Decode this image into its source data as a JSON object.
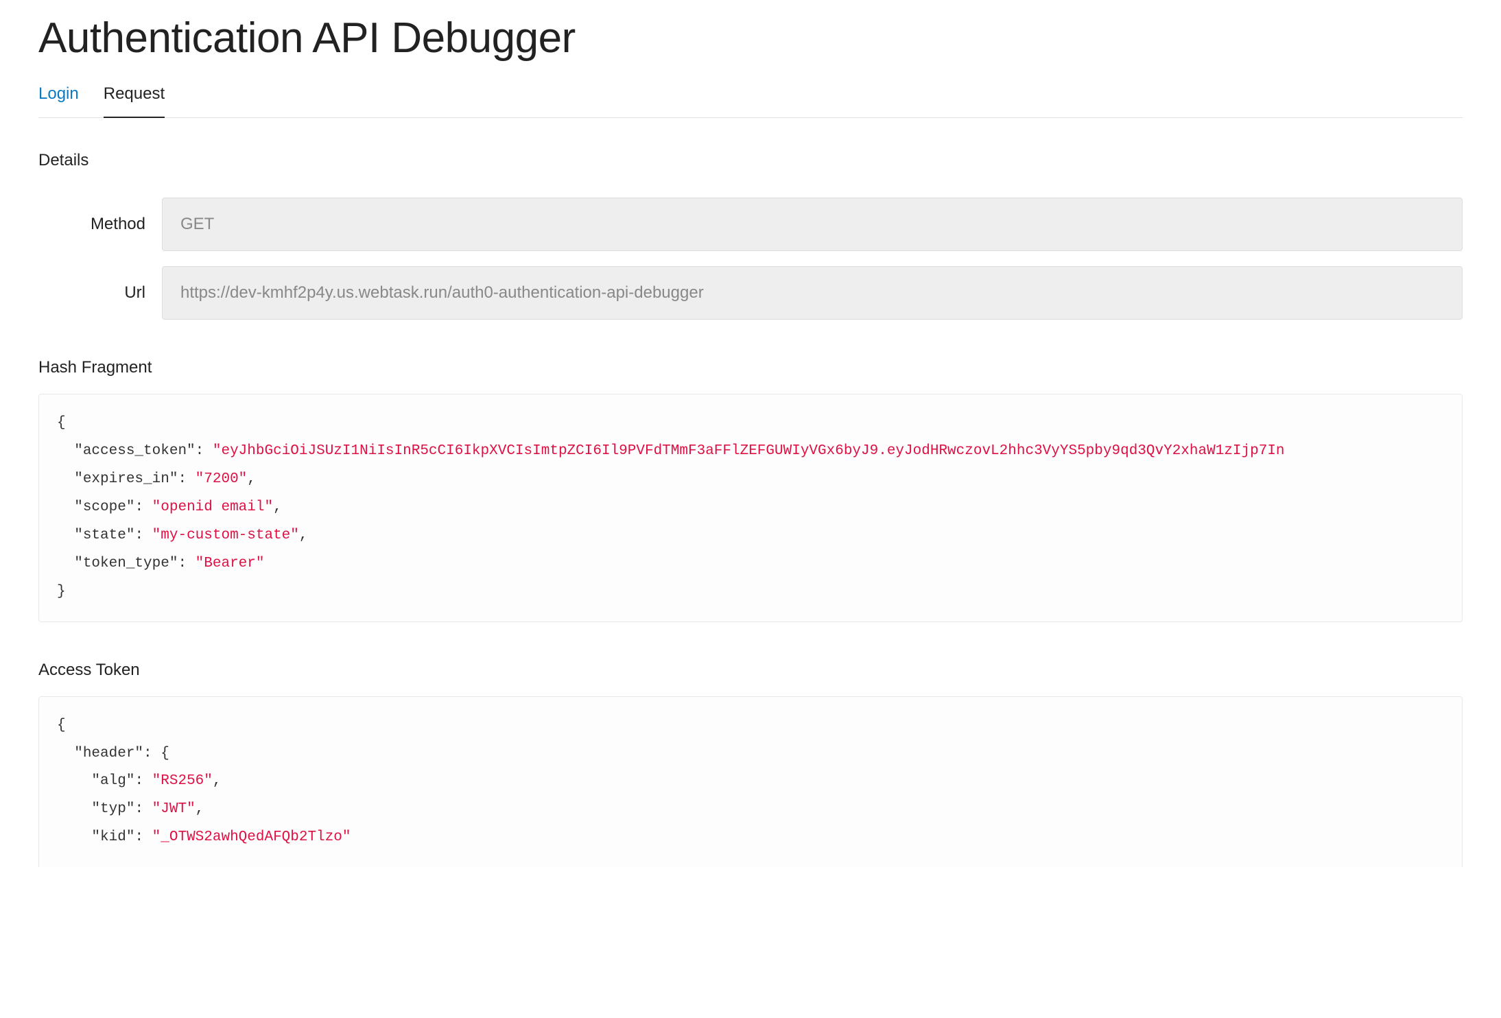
{
  "page": {
    "title": "Authentication API Debugger"
  },
  "tabs": {
    "login": "Login",
    "request": "Request"
  },
  "sections": {
    "details": "Details",
    "hash_fragment": "Hash Fragment",
    "access_token": "Access Token"
  },
  "details": {
    "method_label": "Method",
    "method_value": "GET",
    "url_label": "Url",
    "url_value": "https://dev-kmhf2p4y.us.webtask.run/auth0-authentication-api-debugger"
  },
  "hash_fragment": {
    "access_token_key": "\"access_token\"",
    "access_token_value": "\"eyJhbGciOiJSUzI1NiIsInR5cCI6IkpXVCIsImtpZCI6Il9PVFdTMmF3aFFlZEFGUWIyVGx6byJ9.eyJodHRwczovL2hhc3VyYS5pby9qd3QvY2xhaW1zIjp7In",
    "expires_in_key": "\"expires_in\"",
    "expires_in_value": "\"7200\"",
    "scope_key": "\"scope\"",
    "scope_value": "\"openid email\"",
    "state_key": "\"state\"",
    "state_value": "\"my-custom-state\"",
    "token_type_key": "\"token_type\"",
    "token_type_value": "\"Bearer\""
  },
  "access_token_decoded": {
    "header_key": "\"header\"",
    "alg_key": "\"alg\"",
    "alg_value": "\"RS256\"",
    "typ_key": "\"typ\"",
    "typ_value": "\"JWT\"",
    "kid_key": "\"kid\"",
    "kid_value": "\"_OTWS2awhQedAFQb2Tlzo\""
  }
}
